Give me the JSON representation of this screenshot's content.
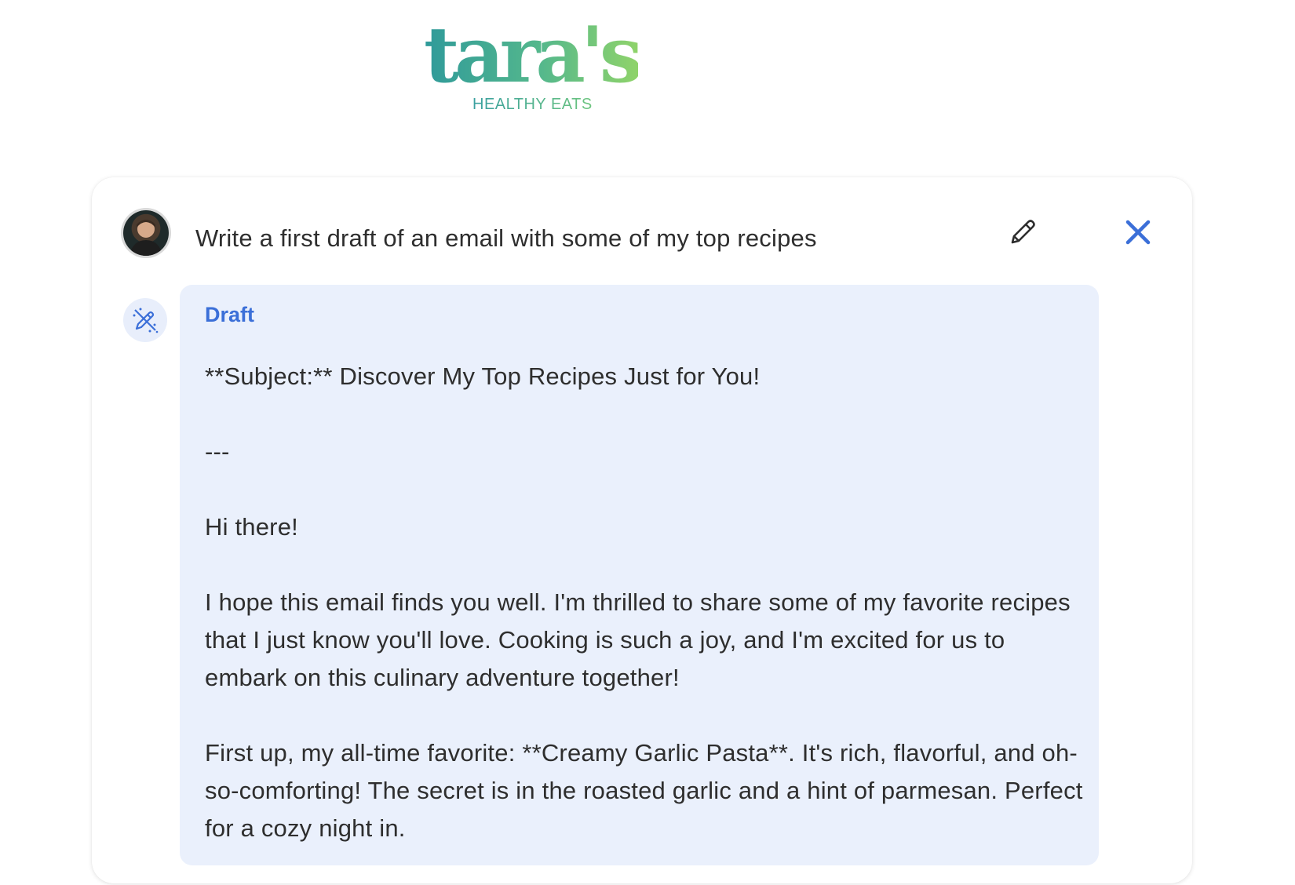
{
  "brand": {
    "logo_word": "tara's",
    "logo_tagline": "HEALTHY EATS"
  },
  "prompt": {
    "text": "Write a first draft of an email with some of my top recipes",
    "edit_icon": "pencil-icon",
    "close_icon": "close-icon"
  },
  "draft": {
    "label": "Draft",
    "icon": "magic-pencil-icon",
    "paragraphs": [
      "**Subject:** Discover My Top Recipes Just for You!",
      "---",
      "Hi there!",
      "I hope this email finds you well. I'm thrilled to share some of my favorite recipes that I just know you'll love. Cooking is such a joy, and I'm excited for us to embark on this culinary adventure together!",
      "First up, my all-time favorite: **Creamy Garlic Pasta**. It's rich, flavorful, and oh-so-comforting! The secret is in the roasted garlic and a hint of parmesan. Perfect for a cozy night in."
    ]
  },
  "colors": {
    "accent": "#3b6fd8",
    "panel": "#eaf0fc",
    "brand_start": "#2f9a9a",
    "brand_end": "#8fd36a"
  }
}
